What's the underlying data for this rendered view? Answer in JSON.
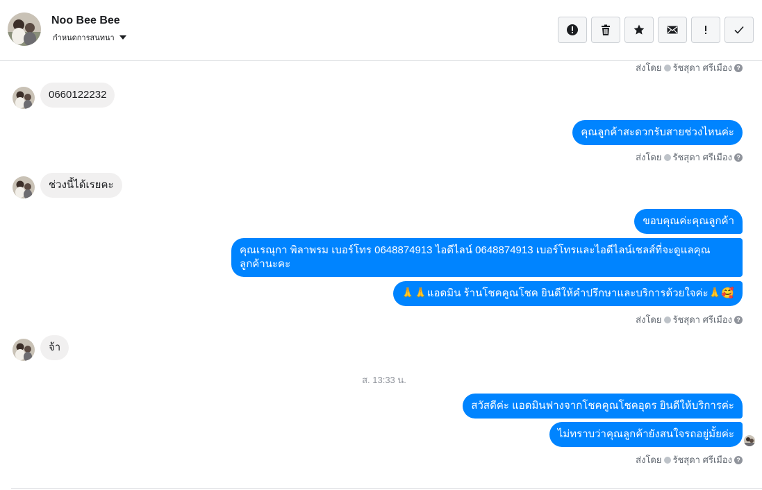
{
  "header": {
    "contact_name": "Noo Bee Bee",
    "assign_label": "กำหนดการสนทนา",
    "actions": [
      "spam-icon",
      "trash-icon",
      "star-icon",
      "mail-icon",
      "important-icon",
      "check-icon"
    ]
  },
  "sent_by": {
    "label": "ส่งโดย",
    "agent": "รัชสุดา ศรีเมือง",
    "help": "?"
  },
  "messages": [
    {
      "dir": "in",
      "text": "0660122232"
    },
    {
      "dir": "out",
      "text": "คุณลูกค้าสะดวกรับสายช่วงไหนค่ะ"
    },
    {
      "dir": "in",
      "text": "ช่วงนี้ได้เรยคะ"
    },
    {
      "dir": "out",
      "text": "ขอบคุณค่ะคุณลูกค้า"
    },
    {
      "dir": "out",
      "text": "คุณเรณุกา พิลาพรม        เบอร์โทร 0648874913  ไอดีไลน์ 0648874913   เบอร์โทรและไอดีไลน์เชลส์ที่จะดูแลคุณลูกค้านะคะ"
    },
    {
      "dir": "out",
      "text": "🙏🙏แอดมิน ร้านโชคคูณโชค ยินดีให้คำปรึกษาและบริการด้วยใจค่ะ🙏🥰"
    },
    {
      "dir": "in",
      "text": "จ้า"
    },
    {
      "dir": "out",
      "text": "สวัสดีค่ะ แอดมินฟางจากโชคคูณโชคอุดร ยินดีให้บริการค่ะ"
    },
    {
      "dir": "out",
      "text": "ไม่ทราบว่าคุณลูกค้ายังสนใจรถอยู่มั้ยค่ะ"
    }
  ],
  "timestamp": "ส. 13:33 น."
}
